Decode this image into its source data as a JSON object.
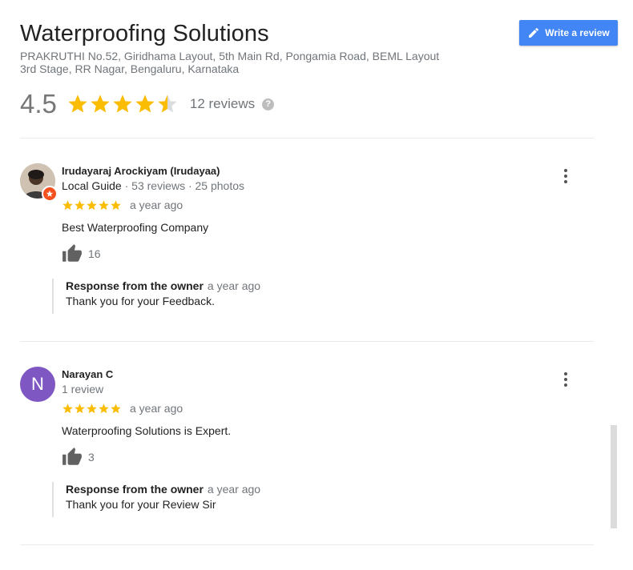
{
  "business": {
    "title": "Waterproofing Solutions",
    "address_line1": "PRAKRUTHI No.52, Giridhama Layout, 5th Main Rd, Pongamia Road, BEML Layout",
    "address_line2": "3rd Stage, RR Nagar, Bengaluru, Karnataka",
    "rating": "4.5",
    "rating_value": 4.5,
    "reviews_count": "12 reviews",
    "help_icon": "?"
  },
  "write_review": {
    "label": "Write a review",
    "icon": "pencil-icon"
  },
  "colors": {
    "accent": "#4285f4",
    "star": "#fbbc04",
    "avatar_purple": "#7e57c2",
    "local_guide_badge": "#f4511e"
  },
  "reviews": [
    {
      "name": "Irudayaraj Arockiyam (Irudayaa)",
      "local_guide": "Local Guide",
      "meta": " · 53 reviews · 25 photos",
      "stars": 5,
      "time": "a year ago",
      "text": "Best Waterproofing Company",
      "likes": "16",
      "response_label": "Response from the owner",
      "response_time": "a year ago",
      "response_text": "Thank you for your Feedback."
    },
    {
      "name": "Narayan C",
      "initial": "N",
      "meta": "1 review",
      "stars": 5,
      "time": "a year ago",
      "text": "Waterproofing Solutions is Expert.",
      "likes": "3",
      "response_label": "Response from the owner",
      "response_time": "a year ago",
      "response_text": "Thank you for your Review Sir"
    }
  ]
}
